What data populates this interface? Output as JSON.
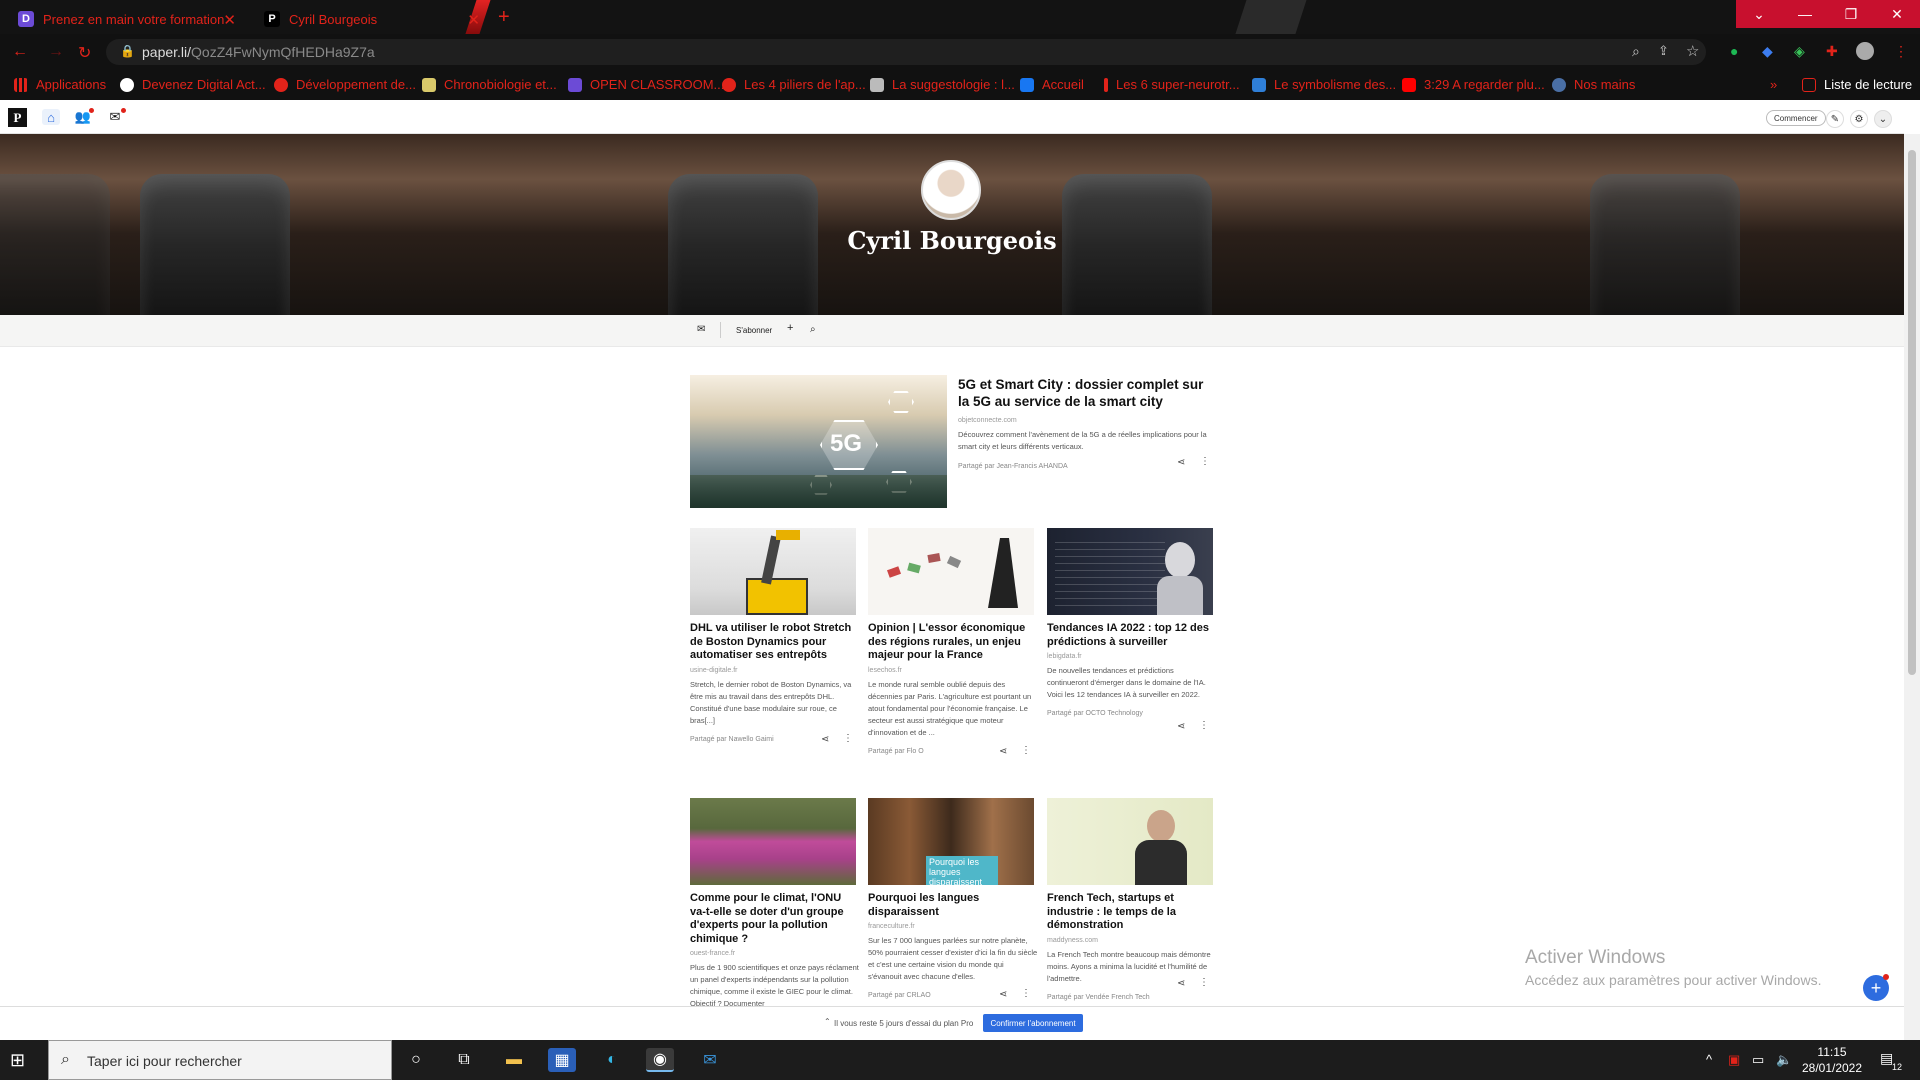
{
  "browser": {
    "tabs": [
      {
        "title": "Prenez en main votre formation"
      },
      {
        "title": "Cyril Bourgeois"
      }
    ],
    "url_host": "paper.li/",
    "url_path": "QozZ4FwNymQfHEDHa9Z7a",
    "bookmarks": [
      {
        "label": "Applications"
      },
      {
        "label": "Devenez Digital Act..."
      },
      {
        "label": "Développement de..."
      },
      {
        "label": "Chronobiologie et..."
      },
      {
        "label": "OPEN CLASSROOM..."
      },
      {
        "label": "Les 4 piliers de l'ap..."
      },
      {
        "label": "La suggestologie : l..."
      },
      {
        "label": "Accueil"
      },
      {
        "label": "Les 6 super-neurotr..."
      },
      {
        "label": "Le symbolisme des..."
      },
      {
        "label": "3:29 A regarder plu..."
      },
      {
        "label": "Nos mains"
      }
    ],
    "reading_list": "Liste de lecture",
    "colors": {
      "accent": "#e2231a",
      "chrome": "#131313"
    }
  },
  "paper": {
    "commencer": "Commencer",
    "profile_name": "Cyril Bourgeois",
    "subscribe": "S'abonner",
    "articles": [
      {
        "title": "5G et Smart City : dossier complet sur la 5G au service de la smart city",
        "domain": "objetconnecte.com",
        "desc": "Découvrez comment l'avènement de la 5G a de réelles implications pour la smart city et leurs différents verticaux.",
        "shared": "Partagé par Jean-Francis AHANDA"
      },
      {
        "title": "DHL va utiliser le robot Stretch de Boston Dynamics pour automatiser ses entrepôts",
        "domain": "usine-digitale.fr",
        "desc": "Stretch, le dernier robot de Boston Dynamics, va être mis au travail dans des entrepôts DHL. Constitué d'une base modulaire sur roue, ce bras[...]",
        "shared": "Partagé par Nawello Gaimi"
      },
      {
        "title": "Opinion | L'essor économique des régions rurales, un enjeu majeur pour la France",
        "domain": "lesechos.fr",
        "desc": "Le monde rural semble oublié depuis des décennies par Paris. L'agriculture est pourtant un atout fondamental pour l'économie française. Le secteur est aussi stratégique que moteur d'innovation et de ...",
        "shared": "Partagé par Flo O"
      },
      {
        "title": "Tendances IA 2022 : top 12 des prédictions à surveiller",
        "domain": "lebigdata.fr",
        "desc": "De nouvelles tendances et prédictions continueront d'émerger dans le domaine de l'IA. Voici les 12 tendances IA à surveiller en 2022.",
        "shared": "Partagé par OCTO Technology"
      },
      {
        "title": "Comme pour le climat, l'ONU va-t-elle se doter d'un groupe d'experts pour la pollution chimique ?",
        "domain": "ouest-france.fr",
        "desc": "Plus de 1 900 scientifiques et onze pays réclament un panel d'experts indépendants sur la pollution chimique, comme il existe le GIEC pour le climat. Objectif ? Documenter",
        "shared": ""
      },
      {
        "title": "Pourquoi les langues disparaissent",
        "domain": "franceculture.fr",
        "desc": "Sur les 7 000 langues parlées sur notre planète, 50% pourraient cesser d'exister d'ici la fin du siècle et c'est une certaine vision du monde qui s'évanouit avec chacune d'elles.",
        "shared": "Partagé par CRLAO",
        "img_caption": "Pourquoi les langues disparaissent"
      },
      {
        "title": "French Tech, startups et industrie : le temps de la démonstration",
        "domain": "maddyness.com",
        "desc": "La French Tech montre beaucoup mais démontre moins. Ayons a minima la lucidité et l'humilité de l'admettre.",
        "shared": "Partagé par Vendée French Tech"
      }
    ],
    "image_5g_label": "5G",
    "promo_text": "Il vous reste 5 jours d'essai du plan Pro",
    "confirm_button": "Confirmer l'abonnement",
    "accent": "#2d6cdf"
  },
  "watermark": {
    "line1": "Activer Windows",
    "line2": "Accédez aux paramètres pour activer Windows."
  },
  "taskbar": {
    "search_placeholder": "Taper ici pour rechercher",
    "time": "11:15",
    "date": "28/01/2022",
    "notif_count": "12"
  }
}
